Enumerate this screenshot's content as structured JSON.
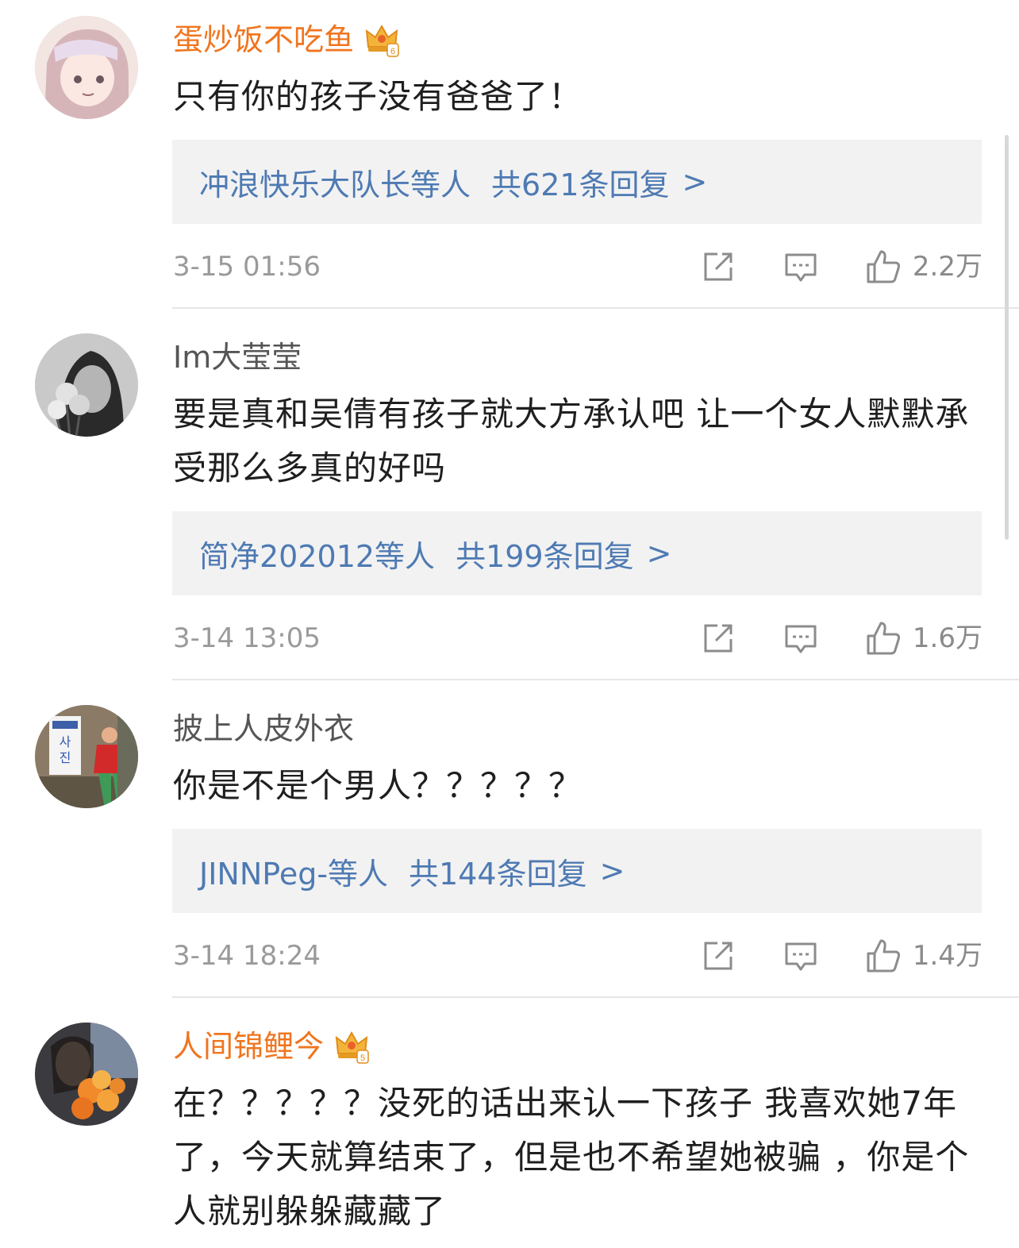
{
  "comments": [
    {
      "username": "蛋炒饭不吃鱼",
      "vip": true,
      "vip_level": "6",
      "text": "只有你的孩子没有爸爸了！",
      "reply_names": "冲浪快乐大队长等人",
      "reply_count": "共621条回复",
      "reply_arrow": ">",
      "time": "3-15 01:56",
      "likes": "2.2万"
    },
    {
      "username": "Im大莹莹",
      "vip": false,
      "text": "要是真和吴倩有孩子就大方承认吧 让一个女人默默承受那么多真的好吗",
      "reply_names": "简净202012等人",
      "reply_count": "共199条回复",
      "reply_arrow": ">",
      "time": "3-14 13:05",
      "likes": "1.6万"
    },
    {
      "username": "披上人皮外衣",
      "vip": false,
      "text": "你是不是个男人？？？？？",
      "reply_names": "JINNPeg-等人",
      "reply_count": "共144条回复",
      "reply_arrow": ">",
      "time": "3-14 18:24",
      "likes": "1.4万"
    },
    {
      "username": "人间锦鲤今",
      "vip": true,
      "vip_level": "5",
      "text": "在？？？？？没死的话出来认一下孩子  我喜欢她7年了，今天就算结束了，但是也不希望她被骗 ，你是个人就别躲躲藏藏了"
    }
  ],
  "colors": {
    "vip_name": "#f0751f",
    "normal_name": "#555555",
    "reply_link": "#4e7ab3",
    "reply_bg": "#f2f2f2",
    "meta_text": "#9a9a9a"
  },
  "icons": {
    "vip": "crown-badge-icon",
    "share": "share-icon",
    "comment": "comment-icon",
    "like": "thumbs-up-icon"
  }
}
